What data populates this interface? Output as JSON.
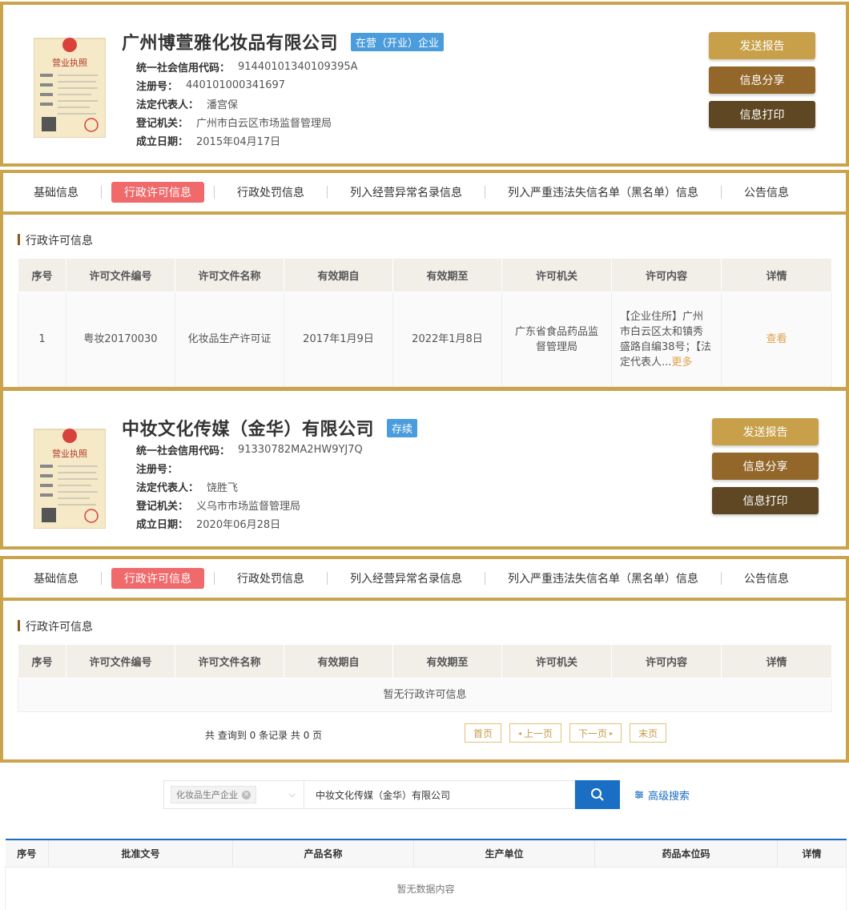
{
  "companies": [
    {
      "name": "广州博萱雅化妆品有限公司",
      "status": "在营（开业）企业",
      "status_color": "#4a9cdc",
      "fields": [
        {
          "label": "统一社会信用代码：",
          "value": "91440101340109395A"
        },
        {
          "label": "注册号：",
          "value": "440101000341697"
        },
        {
          "label": "法定代表人：",
          "value": "潘宫保"
        },
        {
          "label": "登记机关：",
          "value": "广州市白云区市场监督管理局"
        },
        {
          "label": "成立日期：",
          "value": "2015年04月17日"
        }
      ],
      "license_title": "营业执照"
    },
    {
      "name": "中妆文化传媒（金华）有限公司",
      "status": "存续",
      "status_color": "#4a9cdc",
      "fields": [
        {
          "label": "统一社会信用代码：",
          "value": "91330782MA2HW9YJ7Q"
        },
        {
          "label": "注册号：",
          "value": ""
        },
        {
          "label": "法定代表人：",
          "value": "饶胜飞"
        },
        {
          "label": "登记机关：",
          "value": "义乌市市场监督管理局"
        },
        {
          "label": "成立日期：",
          "value": "2020年06月28日"
        }
      ],
      "license_title": "营业执照"
    }
  ],
  "actions": {
    "send_report": "发送报告",
    "share": "信息分享",
    "print": "信息打印"
  },
  "tabs": [
    "基础信息",
    "行政许可信息",
    "行政处罚信息",
    "列入经营异常名录信息",
    "列入严重违法失信名单（黑名单）信息",
    "公告信息"
  ],
  "section_title": "行政许可信息",
  "perm_headers": [
    "序号",
    "许可文件编号",
    "许可文件名称",
    "有效期自",
    "有效期至",
    "许可机关",
    "许可内容",
    "详情"
  ],
  "perm_row": {
    "index": "1",
    "doc_no": "粤妆20170030",
    "doc_name": "化妆品生产许可证",
    "valid_from": "2017年1月9日",
    "valid_to": "2022年1月8日",
    "authority": "广东省食品药品监督管理局",
    "content": "【企业住所】广州市白云区太和镇秀盛路自编38号；【法定代表人...",
    "more": "更多",
    "detail": "查看"
  },
  "empty_perm": "暂无行政许可信息",
  "pager": {
    "count": "共 查询到 0 条记录 共 0 页",
    "first": "首页",
    "prev": "上一页",
    "next": "下一页",
    "last": "末页"
  },
  "search": {
    "category_tag": "化妆品生产企业",
    "query": "中妆文化传媒（金华）有限公司",
    "advanced": "高级搜索"
  },
  "prod_headers": [
    "序号",
    "批准文号",
    "产品名称",
    "生产单位",
    "药品本位码",
    "详情"
  ],
  "prod_empty": "暂无数据内容",
  "colors": {
    "gold": "#c9a44c",
    "active_tab": "#f0696b",
    "blue": "#1a6fc4"
  }
}
